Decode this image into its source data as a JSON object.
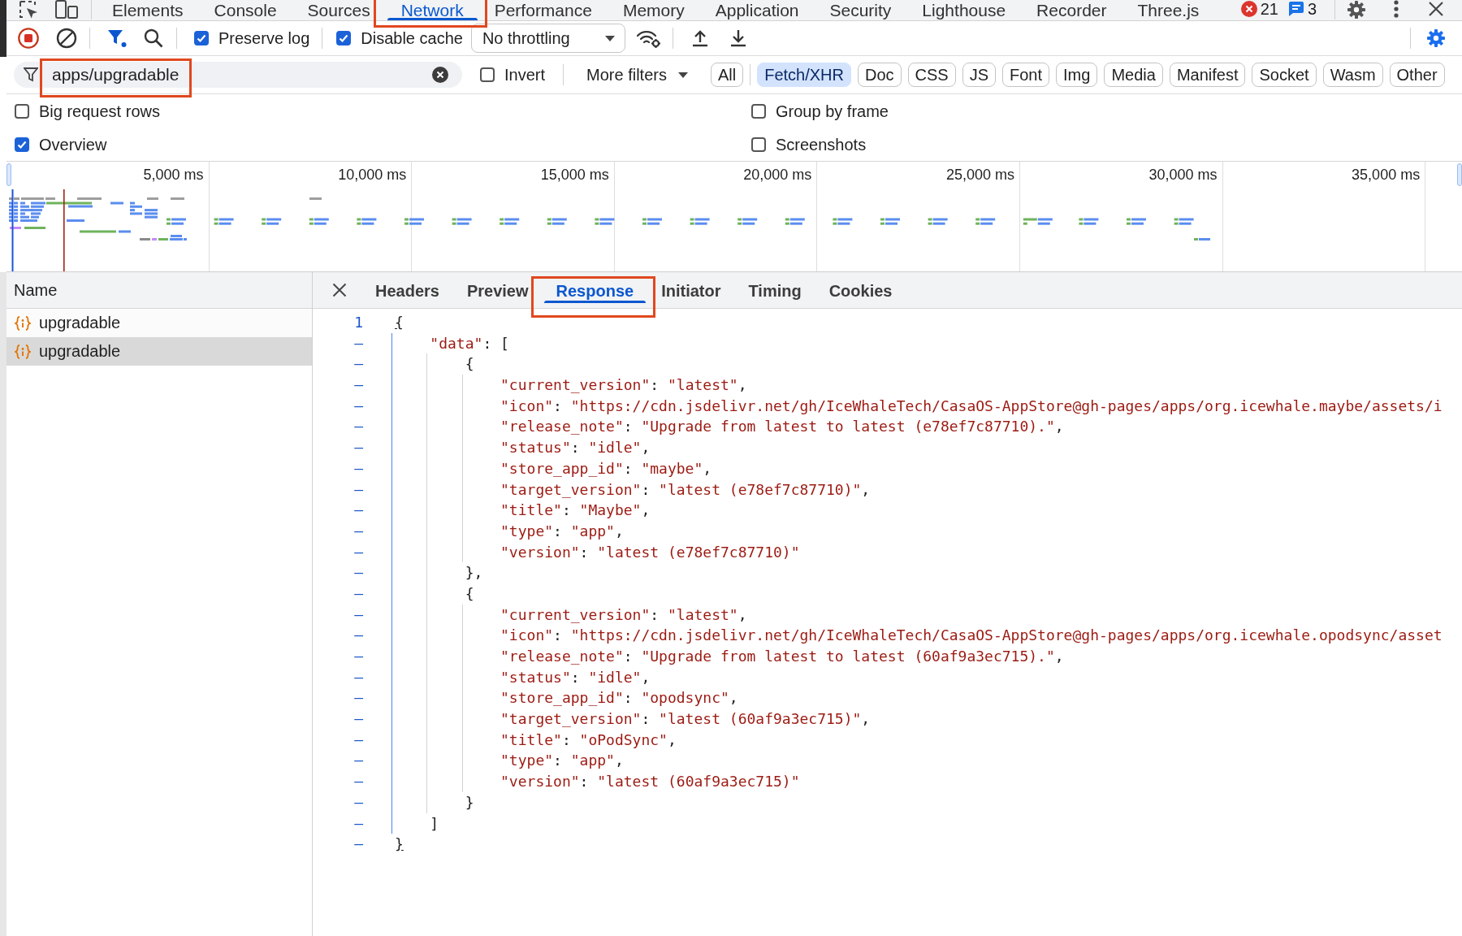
{
  "devtools_tabs": [
    {
      "label": "Elements",
      "selected": false,
      "highlighted": false
    },
    {
      "label": "Console",
      "selected": false,
      "highlighted": false
    },
    {
      "label": "Sources",
      "selected": false,
      "highlighted": false
    },
    {
      "label": "Network",
      "selected": true,
      "highlighted": true
    },
    {
      "label": "Performance",
      "selected": false,
      "highlighted": false
    },
    {
      "label": "Memory",
      "selected": false,
      "highlighted": false
    },
    {
      "label": "Application",
      "selected": false,
      "highlighted": false
    },
    {
      "label": "Security",
      "selected": false,
      "highlighted": false
    },
    {
      "label": "Lighthouse",
      "selected": false,
      "highlighted": false
    },
    {
      "label": "Recorder",
      "selected": false,
      "highlighted": false
    },
    {
      "label": "Three.js",
      "selected": false,
      "highlighted": false
    }
  ],
  "issue_counts": {
    "errors": "21",
    "messages": "3"
  },
  "toolbar": {
    "recording": true,
    "preserve_log": {
      "label": "Preserve log",
      "checked": true
    },
    "disable_cache": {
      "label": "Disable cache",
      "checked": true
    },
    "throttling": "No throttling"
  },
  "filter": {
    "value": "apps/upgradable",
    "highlighted": true,
    "invert": {
      "label": "Invert",
      "checked": false
    },
    "more_filters": "More filters",
    "types": [
      {
        "label": "All",
        "selected": false
      },
      {
        "label": "Fetch/XHR",
        "selected": true
      },
      {
        "label": "Doc",
        "selected": false
      },
      {
        "label": "CSS",
        "selected": false
      },
      {
        "label": "JS",
        "selected": false
      },
      {
        "label": "Font",
        "selected": false
      },
      {
        "label": "Img",
        "selected": false
      },
      {
        "label": "Media",
        "selected": false
      },
      {
        "label": "Manifest",
        "selected": false
      },
      {
        "label": "Socket",
        "selected": false
      },
      {
        "label": "Wasm",
        "selected": false
      },
      {
        "label": "Other",
        "selected": false
      }
    ]
  },
  "options": [
    {
      "label": "Big request rows",
      "checked": false
    },
    {
      "label": "Group by frame",
      "checked": false
    },
    {
      "label": "Overview",
      "checked": true
    },
    {
      "label": "Screenshots",
      "checked": false
    }
  ],
  "overview": {
    "ticks": [
      "5,000 ms",
      "10,000 ms",
      "15,000 ms",
      "20,000 ms",
      "25,000 ms",
      "30,000 ms",
      "35,000 ms"
    ]
  },
  "requests": {
    "column": "Name",
    "rows": [
      {
        "name": "upgradable",
        "selected": false
      },
      {
        "name": "upgradable",
        "selected": true
      }
    ]
  },
  "detail_tabs": [
    {
      "label": "Headers",
      "selected": false,
      "highlighted": false
    },
    {
      "label": "Preview",
      "selected": false,
      "highlighted": false
    },
    {
      "label": "Response",
      "selected": true,
      "highlighted": true
    },
    {
      "label": "Initiator",
      "selected": false,
      "highlighted": false
    },
    {
      "label": "Timing",
      "selected": false,
      "highlighted": false
    },
    {
      "label": "Cookies",
      "selected": false,
      "highlighted": false
    }
  ],
  "response": {
    "lines": [
      {
        "number": "1",
        "text": "{",
        "matched": true,
        "children": [
          {
            "number": "–",
            "text": "\"data\": [",
            "matched": false,
            "children": [
              {
                "number": "–",
                "text": "{",
                "matched": false,
                "children": [
                  {
                    "number": "–",
                    "text": "\"current_version\": \"latest\",",
                    "matched": false
                  },
                  {
                    "number": "–",
                    "text": "\"icon\": \"https://cdn.jsdelivr.net/gh/IceWhaleTech/CasaOS-AppStore@gh-pages/apps/org.icewhale.maybe/assets/i",
                    "matched": false
                  },
                  {
                    "number": "–",
                    "text": "\"release_note\": \"Upgrade from latest to latest (e78ef7c87710).\",",
                    "matched": false
                  },
                  {
                    "number": "–",
                    "text": "\"status\": \"idle\",",
                    "matched": false
                  },
                  {
                    "number": "–",
                    "text": "\"store_app_id\": \"maybe\",",
                    "matched": false
                  },
                  {
                    "number": "–",
                    "text": "\"target_version\": \"latest (e78ef7c87710)\",",
                    "matched": false
                  },
                  {
                    "number": "–",
                    "text": "\"title\": \"Maybe\",",
                    "matched": false
                  },
                  {
                    "number": "–",
                    "text": "\"type\": \"app\",",
                    "matched": false
                  },
                  {
                    "number": "–",
                    "text": "\"version\": \"latest (e78ef7c87710)\"",
                    "matched": false
                  }
                ]
              },
              {
                "number": "–",
                "text": "},",
                "matched": false
              },
              {
                "number": "–",
                "text": "{",
                "matched": false,
                "children": [
                  {
                    "number": "–",
                    "text": "\"current_version\": \"latest\",",
                    "matched": false
                  },
                  {
                    "number": "–",
                    "text": "\"icon\": \"https://cdn.jsdelivr.net/gh/IceWhaleTech/CasaOS-AppStore@gh-pages/apps/org.icewhale.opodsync/asset",
                    "matched": false
                  },
                  {
                    "number": "–",
                    "text": "\"release_note\": \"Upgrade from latest to latest (60af9a3ec715).\",",
                    "matched": false
                  },
                  {
                    "number": "–",
                    "text": "\"status\": \"idle\",",
                    "matched": false
                  },
                  {
                    "number": "–",
                    "text": "\"store_app_id\": \"opodsync\",",
                    "matched": false
                  },
                  {
                    "number": "–",
                    "text": "\"target_version\": \"latest (60af9a3ec715)\",",
                    "matched": false
                  },
                  {
                    "number": "–",
                    "text": "\"title\": \"oPodSync\",",
                    "matched": false
                  },
                  {
                    "number": "–",
                    "text": "\"type\": \"app\",",
                    "matched": false
                  },
                  {
                    "number": "–",
                    "text": "\"version\": \"latest (60af9a3ec715)\"",
                    "matched": false
                  }
                ]
              },
              {
                "number": "–",
                "text": "}",
                "matched": false
              }
            ]
          },
          {
            "number": "–",
            "text": "]",
            "matched": false
          }
        ]
      },
      {
        "number": "–",
        "text": "}",
        "matched": true
      }
    ]
  }
}
